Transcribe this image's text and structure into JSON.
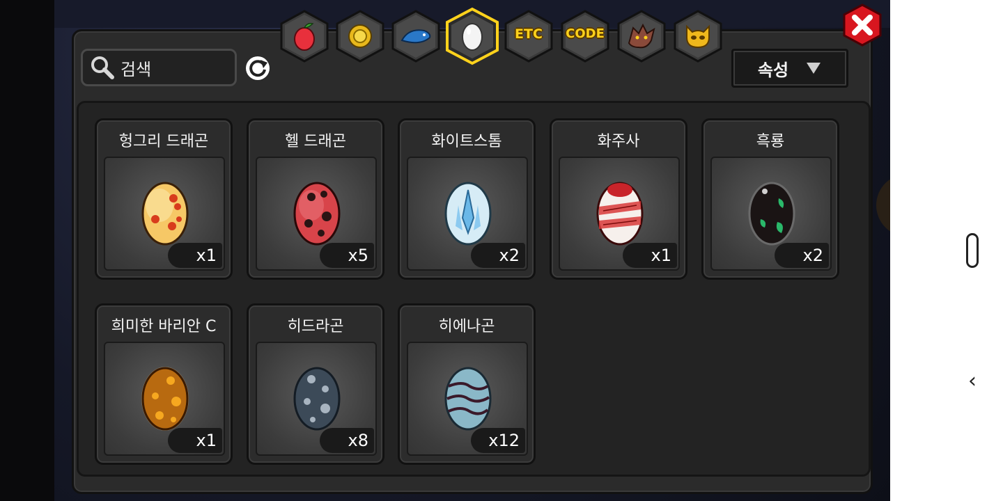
{
  "search": {
    "placeholder": "검색"
  },
  "sort": {
    "label": "속성"
  },
  "tabs": [
    {
      "name": "food",
      "icon": "fruit-icon",
      "label": ""
    },
    {
      "name": "gold",
      "icon": "gold-coin-icon",
      "label": ""
    },
    {
      "name": "fish",
      "icon": "fish-icon",
      "label": ""
    },
    {
      "name": "egg",
      "icon": "egg-icon",
      "label": "",
      "selected": true
    },
    {
      "name": "etc",
      "icon": "",
      "label": "ETC"
    },
    {
      "name": "code",
      "icon": "",
      "label": "CODE"
    },
    {
      "name": "dragon",
      "icon": "dragon-head-icon",
      "label": ""
    },
    {
      "name": "mask",
      "icon": "gold-mask-icon",
      "label": ""
    }
  ],
  "colors": {
    "accent": "#ffd21c",
    "close": "#d8161f",
    "panel": "#2b2b2b"
  },
  "eggs": [
    {
      "name": "헝그리 드래곤",
      "count": "x1",
      "style": "hungry"
    },
    {
      "name": "헬 드래곤",
      "count": "x5",
      "style": "hell"
    },
    {
      "name": "화이트스톰",
      "count": "x2",
      "style": "whitestorm"
    },
    {
      "name": "화주사",
      "count": "x1",
      "style": "hwajusa"
    },
    {
      "name": "흑룡",
      "count": "x2",
      "style": "black"
    },
    {
      "name": "희미한 바리안 C",
      "count": "x1",
      "style": "varian"
    },
    {
      "name": "히드라곤",
      "count": "x8",
      "style": "hydragon"
    },
    {
      "name": "히에나곤",
      "count": "x12",
      "style": "hyenagon"
    }
  ]
}
